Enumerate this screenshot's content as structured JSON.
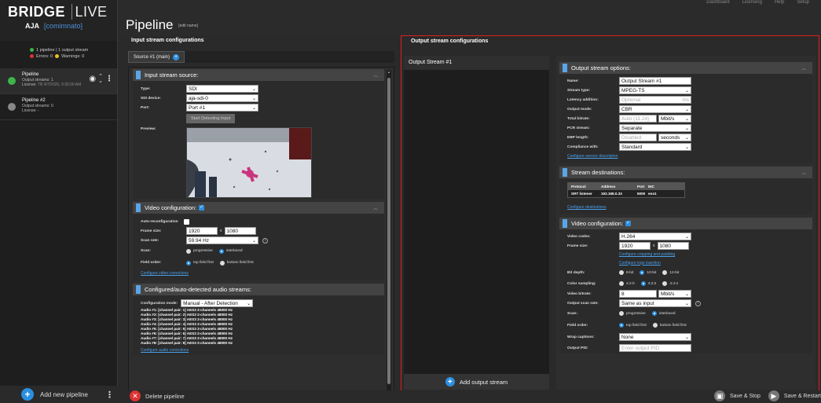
{
  "app": {
    "brand_name": "BRIDGE",
    "brand_suffix": "LIVE",
    "brand_aja": "AJA",
    "brand_sub": "[comimnato]"
  },
  "summary": {
    "pipelines": "1 pipeline | 1 output stream",
    "errors": "Errors: 0",
    "warnings": "Warnings: 0"
  },
  "pipelines": [
    {
      "name": "Pipeline",
      "outputs": "Output streams: 1",
      "license_label": "License:",
      "license_value": "TB 4/7/2025, 9:30:00 AM"
    },
    {
      "name": "Pipeline #2",
      "outputs": "Output streams: 0",
      "license_label": "License:",
      "license_value": "-"
    }
  ],
  "sidebar_footer": {
    "add_label": "Add new pipeline",
    "delete_label": "Delete pipeline"
  },
  "header": {
    "title": "Pipeline",
    "edit": "[edit name]",
    "top_actions": [
      "Dashboard",
      "Licensing",
      "Help",
      "Setup"
    ]
  },
  "input": {
    "header": "Input stream configurations",
    "tab": "Source #1 (main)",
    "source": {
      "title": "Input stream source:",
      "type_label": "Type:",
      "type_value": "SDI",
      "device_label": "SDI device:",
      "device_value": "aja-sdi-0",
      "port_label": "Port:",
      "port_value": "Port #1",
      "detect_button": "Start Detecting Input",
      "preview_label": "Preview:"
    },
    "video": {
      "title": "Video configuration:",
      "auto_label": "Auto-reconfiguration",
      "frame_label": "Frame size:",
      "width": "1920",
      "x": "x",
      "height": "1080",
      "scan_rate_label": "Scan rate:",
      "scan_rate_value": "59.94 Hz",
      "scan_label": "Scan:",
      "progressive": "progressive",
      "interlaced": "interlaced",
      "field_label": "Field order:",
      "top_first": "top field first",
      "bottom_first": "bottom field first",
      "corrections_link": "Configure video corrections"
    },
    "audio": {
      "title": "Configured/auto-detected audio streams:",
      "mode_label": "Configuration mode:",
      "mode_value": "Manual - After Detection",
      "streams": [
        "Audio #1: [channel pair: 1] AES3 2-channels 48000 Hz",
        "Audio #2: [channel pair: 2] AES3 2-channels 48000 Hz",
        "Audio #3: [channel pair: 3] AES3 2-channels 48000 Hz",
        "Audio #4: [channel pair: 4] AES3 2-channels 48000 Hz",
        "Audio #5: [channel pair: 5] AES3 2-channels 48000 Hz",
        "Audio #6: [channel pair: 6] AES3 2-channels 48000 Hz",
        "Audio #7: [channel pair: 7] AES3 2-channels 48000 Hz",
        "Audio #8: [channel pair: 8] AES3 2-channels 48000 Hz"
      ],
      "corrections_link": "Configure audio corrections"
    }
  },
  "output": {
    "header": "Output stream configurations",
    "list": [
      "Output Stream #1"
    ],
    "add_label": "Add output stream",
    "options": {
      "title": "Output stream options:",
      "name_label": "Name:",
      "name_value": "Output Stream #1",
      "type_label": "Stream type:",
      "type_value": "MPEG-TS",
      "latency_label": "Latency addition:",
      "latency_placeholder": "Optional",
      "latency_unit": "ms",
      "mode_label": "Output mode:",
      "mode_value": "CBR",
      "bitrate_label": "Total bitrate:",
      "bitrate_placeholder": "Auto (11.24)",
      "bitrate_unit": "Mbit/s",
      "pcr_label": "PCR stream:",
      "pcr_value": "Separate",
      "ebp_label": "EBP length:",
      "ebp_placeholder": "Disabled",
      "ebp_unit": "seconds",
      "compliance_label": "Compliance with:",
      "compliance_value": "Standard",
      "service_link": "Configure service description"
    },
    "destinations": {
      "title": "Stream destinations:",
      "columns": [
        "Protocol",
        "Address",
        "Port",
        "NIC"
      ],
      "rows": [
        [
          "SRT listener",
          "192.168.0.33",
          "5000",
          "eno1"
        ]
      ],
      "link": "Configure destinations"
    },
    "video": {
      "title": "Video configuration:",
      "codec_label": "Video codec:",
      "codec_value": "H.264",
      "frame_label": "Frame size:",
      "width": "1920",
      "x": "x",
      "height": "1080",
      "crop_link": "Configure cropping and padding",
      "logo_link": "Configure logo insertion",
      "depth_label": "Bit depth:",
      "depth_options": [
        "8-bit",
        "10-bit",
        "12-bit"
      ],
      "sampling_label": "Color sampling:",
      "sampling_options": [
        "4:2:0",
        "4:2:2",
        "4:4:4"
      ],
      "bitrate_label": "Video bitrate:",
      "bitrate_value": "8",
      "bitrate_unit": "Mbit/s",
      "scanrate_label": "Output scan rate:",
      "scanrate_value": "Same as input",
      "scan_label": "Scan:",
      "progressive": "progressive",
      "interlaced": "interlaced",
      "field_label": "Field order:",
      "top_first": "top field first",
      "bottom_first": "bottom field first",
      "captions_label": "Wrap captions:",
      "captions_value": "None",
      "pid_label": "Output PID:",
      "pid_placeholder": "Enter output PID"
    }
  },
  "bottom": {
    "save_stop": "Save & Stop",
    "save_restart": "Save & Restart"
  }
}
